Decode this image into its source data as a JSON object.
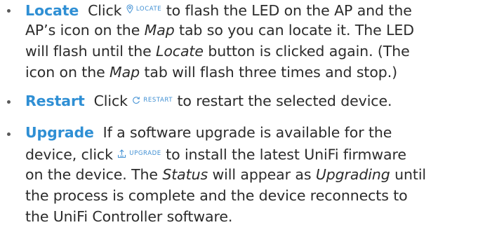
{
  "items": [
    {
      "term": "Locate",
      "lines": [
        {
          "pre": "Click",
          "button_label": "LOCATE",
          "button_icon": "location-pin-icon",
          "post": "to flash the LED on the AP and the"
        },
        {
          "text": "AP’s icon on the"
        },
        {
          "text": "will flash until the"
        },
        {
          "text": "icon on the"
        }
      ],
      "line1_tab": "Map",
      "line1_post": "tab so you can locate it. The LED",
      "line2_italic": "Locate",
      "line2_post": "button is clicked again. (The",
      "line3_italic": "Map",
      "line3_post": "tab will flash three times and stop.)"
    },
    {
      "term": "Restart",
      "pre": "Click",
      "button_label": "RESTART",
      "button_icon": "restart-icon",
      "post": "to restart the selected device."
    },
    {
      "term": "Upgrade",
      "line0": "If a software upgrade is available for the",
      "line1_pre": "device, click",
      "button_label": "UPGRADE",
      "button_icon": "upgrade-icon",
      "line1_post": "to install the latest UniFi firmware",
      "line2_pre": "on the device. The",
      "line2_italic1": "Status",
      "line2_mid": "will appear as",
      "line2_italic2": "Upgrading",
      "line2_post": "until",
      "line3": "the process is complete and the device reconnects to",
      "line4": "the UniFi Controller software."
    }
  ]
}
